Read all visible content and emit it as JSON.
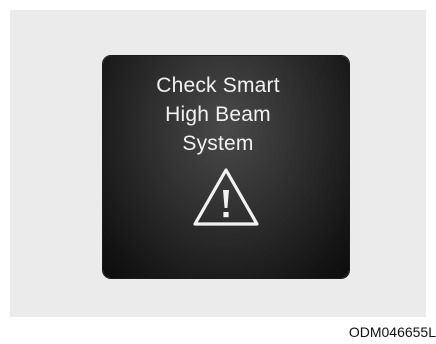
{
  "display": {
    "message_line1": "Check Smart",
    "message_line2": "High Beam",
    "message_line3": "System",
    "icon": "warning-triangle-icon"
  },
  "figure_code": "ODM046655L",
  "colors": {
    "panel_background": "#ebebeb",
    "display_background": "#222222",
    "display_text": "#f2f2f2"
  }
}
